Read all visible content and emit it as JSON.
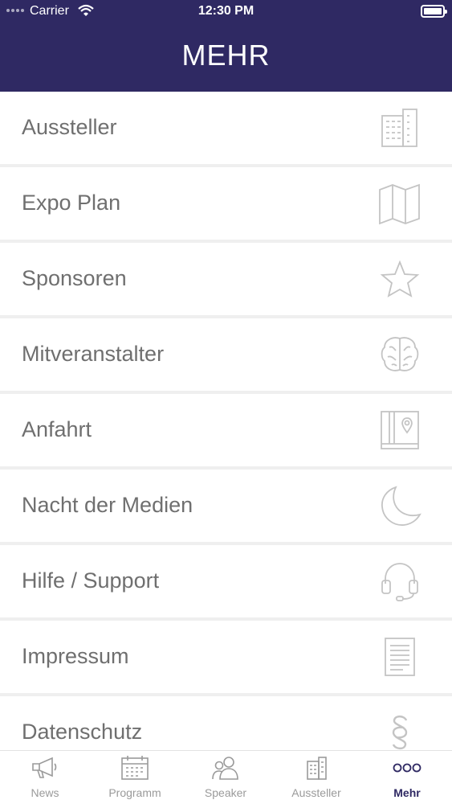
{
  "status_bar": {
    "carrier": "Carrier",
    "time": "12:30 PM"
  },
  "header": {
    "title": "MEHR"
  },
  "menu": [
    {
      "label": "Aussteller",
      "icon": "building-icon"
    },
    {
      "label": "Expo Plan",
      "icon": "map-icon"
    },
    {
      "label": "Sponsoren",
      "icon": "star-icon"
    },
    {
      "label": "Mitveranstalter",
      "icon": "brain-icon"
    },
    {
      "label": "Anfahrt",
      "icon": "map-pin-book-icon"
    },
    {
      "label": "Nacht der Medien",
      "icon": "moon-icon"
    },
    {
      "label": "Hilfe / Support",
      "icon": "headset-icon"
    },
    {
      "label": "Impressum",
      "icon": "document-icon"
    },
    {
      "label": "Datenschutz",
      "icon": "paragraph-icon"
    }
  ],
  "tabbar": [
    {
      "label": "News",
      "icon": "megaphone-icon"
    },
    {
      "label": "Programm",
      "icon": "calendar-icon"
    },
    {
      "label": "Speaker",
      "icon": "people-icon"
    },
    {
      "label": "Aussteller",
      "icon": "building-icon"
    },
    {
      "label": "Mehr",
      "icon": "more-dots-icon",
      "active": true
    }
  ],
  "colors": {
    "header_bg": "#2f2963",
    "label_text": "#6f6f6f",
    "icon_stroke": "#c4c4c4",
    "tab_active": "#2f2963",
    "tab_inactive": "#9a9a9a"
  }
}
